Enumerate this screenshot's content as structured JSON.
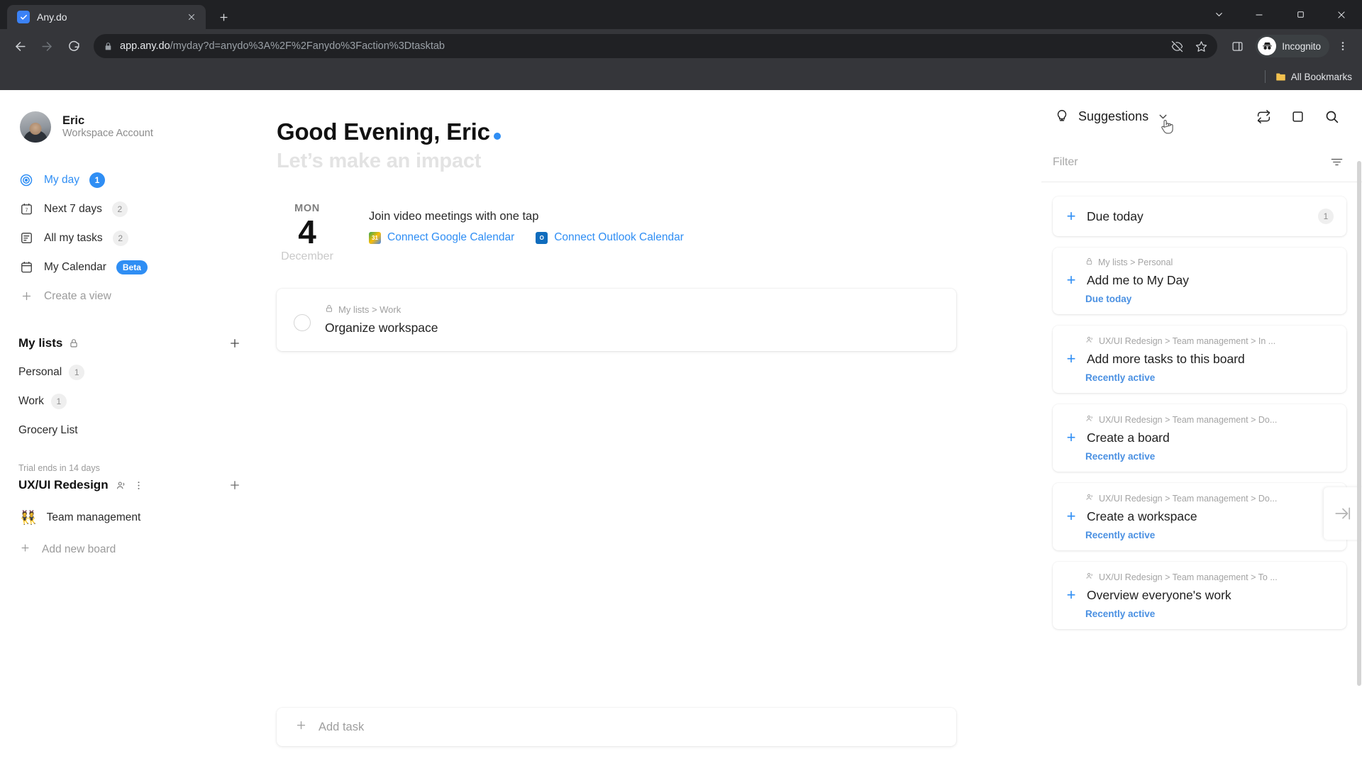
{
  "browser": {
    "tab": {
      "title": "Any.do",
      "favicon": "anydo-check-icon"
    },
    "new_tab_label": "+",
    "url_bold": "app.any.do",
    "url_rest": "/myday?d=anydo%3A%2F%2Fanydo%3Faction%3Dtasktab",
    "profile_label": "Incognito",
    "bookmarks_label": "All Bookmarks"
  },
  "sidebar": {
    "profile": {
      "name": "Eric",
      "subtitle": "Workspace Account"
    },
    "nav": [
      {
        "label": "My day",
        "badge": "1",
        "badge_type": "blue",
        "icon": "target-icon",
        "active": true
      },
      {
        "label": "Next 7 days",
        "badge": "2",
        "badge_type": "grey",
        "icon": "calendar-7-icon",
        "active": false
      },
      {
        "label": "All my tasks",
        "badge": "2",
        "badge_type": "grey",
        "icon": "list-icon",
        "active": false
      },
      {
        "label": "My Calendar",
        "badge": "Beta",
        "badge_type": "beta",
        "icon": "calendar-icon",
        "active": false
      },
      {
        "label": "Create a view",
        "badge": "",
        "badge_type": "none",
        "icon": "plus-icon",
        "active": false
      }
    ],
    "my_lists": {
      "title": "My lists",
      "items": [
        {
          "label": "Personal",
          "badge": "1"
        },
        {
          "label": "Work",
          "badge": "1"
        },
        {
          "label": "Grocery List",
          "badge": ""
        }
      ]
    },
    "workspace": {
      "trial": "Trial ends in 14 days",
      "name": "UX/UI Redesign",
      "boards": [
        {
          "emoji": "👯",
          "label": "Team management"
        }
      ],
      "add_board_label": "Add new board"
    }
  },
  "main": {
    "greeting": "Good Evening, Eric",
    "subgreeting": "Let’s make an impact",
    "date": {
      "dow": "MON",
      "day": "4",
      "month": "December"
    },
    "meeting": {
      "title": "Join video meetings with one tap",
      "google_label": "Connect Google Calendar",
      "outlook_label": "Connect Outlook Calendar"
    },
    "task": {
      "path": "My lists > Work",
      "title": "Organize workspace"
    },
    "add_task_placeholder": "Add task"
  },
  "suggestions": {
    "title": "Suggestions",
    "filter_placeholder": "Filter",
    "group": {
      "label": "Due today",
      "count": "1"
    },
    "cards": [
      {
        "path": "My lists > Personal",
        "path_icon": "lock-icon",
        "name": "Add me to My Day",
        "meta": "Due today"
      },
      {
        "path": "UX/UI Redesign > Team management > In ...",
        "path_icon": "people-icon",
        "name": "Add more tasks to this board",
        "meta": "Recently active"
      },
      {
        "path": "UX/UI Redesign > Team management > Do...",
        "path_icon": "people-icon",
        "name": "Create a board",
        "meta": "Recently active"
      },
      {
        "path": "UX/UI Redesign > Team management > Do...",
        "path_icon": "people-icon",
        "name": "Create a workspace",
        "meta": "Recently active"
      },
      {
        "path": "UX/UI Redesign > Team management > To ...",
        "path_icon": "people-icon",
        "name": "Overview everyone's work",
        "meta": "Recently active"
      }
    ]
  },
  "colors": {
    "accent": "#2f8ef4",
    "link": "#4a90e2",
    "chrome_dark": "#202124",
    "chrome_mid": "#35363a"
  }
}
